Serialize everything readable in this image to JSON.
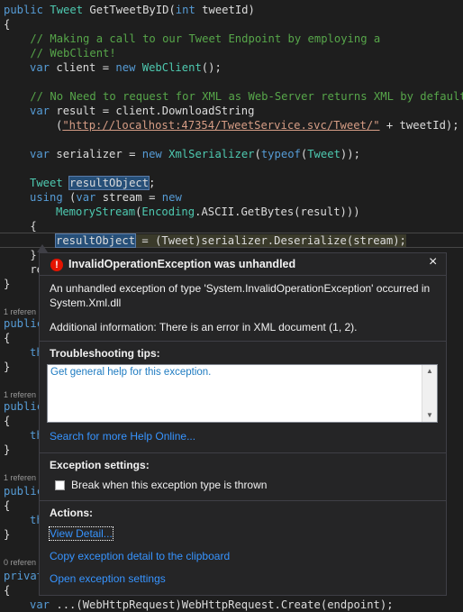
{
  "code": {
    "l1": {
      "kw": "public ",
      "ty": "Tweet",
      "rest": " GetTweetByID(",
      "kw2": "int",
      "rest2": " tweetId)"
    },
    "l2": "{",
    "l3": "    // Making a call to our Tweet Endpoint by employing a",
    "l4": "    // WebClient!",
    "l5": {
      "kw": "var",
      "rest": " client = ",
      "kw2": "new ",
      "ty": "WebClient",
      "rest2": "();"
    },
    "l6": "    // No Need to request for XML as Web-Server returns XML by default.",
    "l7": {
      "kw": "var",
      "rest": " result = client.DownloadString"
    },
    "l8": {
      "open": "(",
      "url": "\"http://localhost:47354/TweetService.svc/Tweet/\"",
      "rest": " + tweetId);"
    },
    "l9": {
      "kw": "var",
      "rest": " serializer = ",
      "kw2": "new ",
      "ty": "XmlSerializer",
      "rest2": "(",
      "kw3": "typeof",
      "rest3": "(",
      "ty2": "Tweet",
      "rest4": "));"
    },
    "l10": {
      "ty": "Tweet",
      "sp": " ",
      "hl": "resultObject",
      "rest": ";"
    },
    "l11": {
      "kw": "using",
      "rest": " (",
      "kw2": "var",
      "rest2": " stream = ",
      "kw3": "new"
    },
    "l12": {
      "ty": "MemoryStream",
      "rest": "(",
      "ty2": "Encoding",
      "rest2": ".ASCII.GetBytes(result)))"
    },
    "l13": "    {",
    "l14": {
      "hl": "resultObject",
      "rest": " = (Tweet)serializer.Deserialize(stream);"
    },
    "l15": "    }",
    "l16": "    re",
    "l17": "}",
    "ref_label": "1 referen",
    "ref_label2": "0 referen",
    "pub": "public",
    "priv": "privat",
    "brace_open": "{",
    "brace_close": "}",
    "th": "th",
    "bottom_line": {
      "kw": "var",
      "rest": " ...(WebHttpRequest)WebHttpRequest.Create(endpoint);"
    }
  },
  "popup": {
    "title": "InvalidOperationException was unhandled",
    "close": "×",
    "message": "An unhandled exception of type 'System.InvalidOperationException' occurred in System.Xml.dll",
    "additional": "Additional information: There is an error in XML document (1, 2).",
    "tips_heading": "Troubleshooting tips:",
    "tip_link": "Get general help for this exception.",
    "search_link": "Search for more Help Online...",
    "settings_heading": "Exception settings:",
    "checkbox_label": "Break when this exception type is thrown",
    "checkbox_checked": false,
    "actions_heading": "Actions:",
    "view_detail": "View Detail...",
    "copy_detail": "Copy exception detail to the clipboard",
    "open_settings": "Open exception settings"
  }
}
